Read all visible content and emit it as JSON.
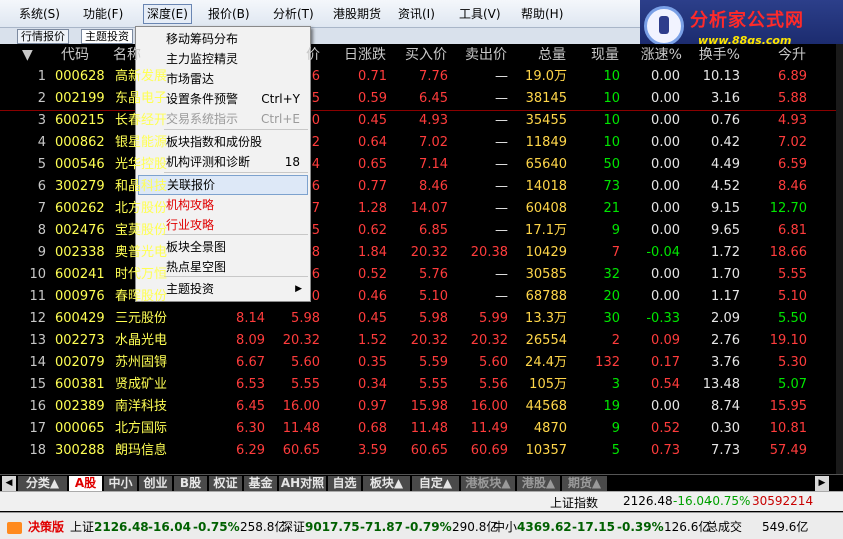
{
  "menubar": {
    "items": [
      "系统(S)",
      "功能(F)",
      "深度(E)",
      "报价(B)",
      "分析(T)",
      "港股期货",
      "资讯(I)",
      "工具(V)",
      "帮助(H)"
    ]
  },
  "logo": {
    "title": "分析家公式网",
    "url_text": "www.88gs.com"
  },
  "top_tabs": [
    "行情报价",
    "主题投资"
  ],
  "columns": {
    "sort_icon": "▼",
    "code": "代码",
    "name": "名称",
    "price": "价",
    "change": "日涨跌",
    "bid": "买入价",
    "ask": "卖出价",
    "total": "总量",
    "current": "现量",
    "speed": "涨速%",
    "turnover": "换手%",
    "pct": "今升"
  },
  "rows": [
    {
      "n": "1",
      "code": "000628",
      "name": "高新发展",
      "price": "",
      "p2": "6",
      "chg": "0.71",
      "bid": "7.76",
      "ask": "—",
      "vol": "19.0万",
      "cur": "10",
      "spd": "0.00",
      "to": "10.13",
      "last": "6.89"
    },
    {
      "n": "2",
      "code": "002199",
      "name": "东晶电子",
      "price": "",
      "p2": "5",
      "chg": "0.59",
      "bid": "6.45",
      "ask": "—",
      "vol": "38145",
      "cur": "10",
      "spd": "0.00",
      "to": "3.16",
      "last": "5.88"
    },
    {
      "n": "3",
      "code": "600215",
      "name": "长春经开",
      "price": "",
      "p2": "0",
      "chg": "0.45",
      "bid": "4.93",
      "ask": "—",
      "vol": "35455",
      "cur": "10",
      "spd": "0.00",
      "to": "0.76",
      "last": "4.93"
    },
    {
      "n": "4",
      "code": "000862",
      "name": "银星能源",
      "price": "",
      "p2": "2",
      "chg": "0.64",
      "bid": "7.02",
      "ask": "—",
      "vol": "11849",
      "cur": "10",
      "spd": "0.00",
      "to": "0.42",
      "last": "7.02"
    },
    {
      "n": "5",
      "code": "000546",
      "name": "光华控股",
      "price": "",
      "p2": "4",
      "chg": "0.65",
      "bid": "7.14",
      "ask": "—",
      "vol": "65640",
      "cur": "50",
      "spd": "0.00",
      "to": "4.49",
      "last": "6.59"
    },
    {
      "n": "6",
      "code": "300279",
      "name": "和晶科技",
      "price": "",
      "p2": "6",
      "chg": "0.77",
      "bid": "8.46",
      "ask": "—",
      "vol": "14018",
      "cur": "73",
      "spd": "0.00",
      "to": "4.52",
      "last": "8.46"
    },
    {
      "n": "7",
      "code": "600262",
      "name": "北方股份",
      "price": "",
      "p2": "7",
      "chg": "1.28",
      "bid": "14.07",
      "ask": "—",
      "vol": "60408",
      "cur": "21",
      "spd": "0.00",
      "to": "9.15",
      "last": "12.70"
    },
    {
      "n": "8",
      "code": "002476",
      "name": "宝莫股份",
      "price": "",
      "p2": "5",
      "chg": "0.62",
      "bid": "6.85",
      "ask": "—",
      "vol": "17.1万",
      "cur": "9",
      "spd": "0.00",
      "to": "9.65",
      "last": "6.81"
    },
    {
      "n": "9",
      "code": "002338",
      "name": "奥普光电",
      "price": "",
      "p2": "8",
      "chg": "1.84",
      "bid": "20.32",
      "ask": "20.38",
      "vol": "10429",
      "cur": "7",
      "spd": "-0.04",
      "to": "1.72",
      "last": "18.66"
    },
    {
      "n": "10",
      "code": "600241",
      "name": "时代万恒",
      "price": "",
      "p2": "6",
      "chg": "0.52",
      "bid": "5.76",
      "ask": "—",
      "vol": "30585",
      "cur": "32",
      "spd": "0.00",
      "to": "1.70",
      "last": "5.55"
    },
    {
      "n": "11",
      "code": "000976",
      "name": "春晖股份",
      "price": "",
      "p2": "0",
      "chg": "0.46",
      "bid": "5.10",
      "ask": "—",
      "vol": "68788",
      "cur": "20",
      "spd": "0.00",
      "to": "1.17",
      "last": "5.10"
    },
    {
      "n": "12",
      "code": "600429",
      "name": "三元股份",
      "price": "8.14",
      "p2": "5.98",
      "chg": "0.45",
      "bid": "5.98",
      "ask": "5.99",
      "vol": "13.3万",
      "cur": "30",
      "spd": "-0.33",
      "to": "2.09",
      "last": "5.50"
    },
    {
      "n": "13",
      "code": "002273",
      "name": "水晶光电",
      "price": "8.09",
      "p2": "20.32",
      "chg": "1.52",
      "bid": "20.32",
      "ask": "20.32",
      "vol": "26554",
      "cur": "2",
      "spd": "0.09",
      "to": "2.76",
      "last": "19.10"
    },
    {
      "n": "14",
      "code": "002079",
      "name": "苏州固锝",
      "price": "6.67",
      "p2": "5.60",
      "chg": "0.35",
      "bid": "5.59",
      "ask": "5.60",
      "vol": "24.4万",
      "cur": "132",
      "spd": "0.17",
      "to": "3.76",
      "last": "5.30"
    },
    {
      "n": "15",
      "code": "600381",
      "name": "贤成矿业",
      "price": "6.53",
      "p2": "5.55",
      "chg": "0.34",
      "bid": "5.55",
      "ask": "5.56",
      "vol": "105万",
      "cur": "3",
      "spd": "0.54",
      "to": "13.48",
      "last": "5.07"
    },
    {
      "n": "16",
      "code": "002389",
      "name": "南洋科技",
      "price": "6.45",
      "p2": "16.00",
      "chg": "0.97",
      "bid": "15.98",
      "ask": "16.00",
      "vol": "44568",
      "cur": "19",
      "spd": "0.00",
      "to": "8.74",
      "last": "15.95"
    },
    {
      "n": "17",
      "code": "000065",
      "name": "北方国际",
      "price": "6.30",
      "p2": "11.48",
      "chg": "0.68",
      "bid": "11.48",
      "ask": "11.49",
      "vol": "4870",
      "cur": "9",
      "spd": "0.52",
      "to": "0.30",
      "last": "10.81"
    },
    {
      "n": "18",
      "code": "300288",
      "name": "朗玛信息",
      "price": "6.29",
      "p2": "60.65",
      "chg": "3.59",
      "bid": "60.65",
      "ask": "60.69",
      "vol": "10357",
      "cur": "5",
      "spd": "0.73",
      "to": "7.73",
      "last": "57.49"
    }
  ],
  "dropdown": {
    "items": [
      {
        "label": "移动筹码分布",
        "shortcut": ""
      },
      {
        "label": "主力监控精灵",
        "shortcut": ""
      },
      {
        "label": "市场雷达",
        "shortcut": ""
      },
      {
        "label": "设置条件预警",
        "shortcut": "Ctrl+Y"
      },
      {
        "label": "交易系统指示",
        "shortcut": "Ctrl+E"
      },
      {
        "label": "板块指数和成份股",
        "shortcut": ""
      },
      {
        "label": "机构评测和诊断",
        "shortcut": "18"
      },
      {
        "label": "关联报价",
        "shortcut": ""
      },
      {
        "label": "机构攻略",
        "shortcut": ""
      },
      {
        "label": "行业攻略",
        "shortcut": ""
      },
      {
        "label": "板块全景图",
        "shortcut": ""
      },
      {
        "label": "热点星空图",
        "shortcut": ""
      },
      {
        "label": "主题投资",
        "shortcut": ""
      }
    ],
    "submenu_arrow": "▶"
  },
  "bottom_tabs": [
    "分类▲",
    "A股",
    "中小",
    "创业",
    "B股",
    "权证",
    "基金",
    "AH对照",
    "自选",
    "板块▲",
    "自定▲",
    "港板块▲",
    "港股▲",
    "期货▲"
  ],
  "nav": {
    "left": "◀",
    "right": "▶"
  },
  "index_row": {
    "name": "上证指数",
    "value": "2126.48",
    "change": "-16.04",
    "pct": "-0.75%",
    "volume": "30592214"
  },
  "status": {
    "edition": "决策版",
    "sh_label": "上证",
    "sh_value": "2126.48",
    "sh_chg": "-16.04",
    "sh_pct": "-0.75%",
    "sh_amt": "258.8亿",
    "sz_label": "深证",
    "sz_value": "9017.75",
    "sz_chg": "-71.87",
    "sz_pct": "-0.79%",
    "sz_amt": "290.8亿",
    "zx_label": "中小",
    "zx_value": "4369.62",
    "zx_chg": "-17.15",
    "zx_pct": "-0.39%",
    "zx_amt": "126.6亿",
    "total_label": "总成交",
    "total_amt": "549.6亿"
  }
}
